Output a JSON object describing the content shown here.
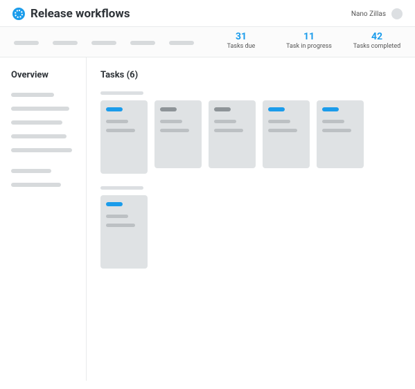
{
  "header": {
    "title": "Release workflows",
    "user_name": "Nano Zillas"
  },
  "stats": [
    {
      "value": "31",
      "label": "Tasks due"
    },
    {
      "value": "11",
      "label": "Task in progress"
    },
    {
      "value": "42",
      "label": "Tasks completed"
    }
  ],
  "sidebar": {
    "title": "Overview"
  },
  "main": {
    "title": "Tasks (6)"
  },
  "cards": {
    "row1": [
      {
        "status": "blue"
      },
      {
        "status": "grey"
      },
      {
        "status": "grey"
      },
      {
        "status": "blue"
      },
      {
        "status": "blue"
      }
    ],
    "row2": [
      {
        "status": "blue"
      }
    ]
  }
}
